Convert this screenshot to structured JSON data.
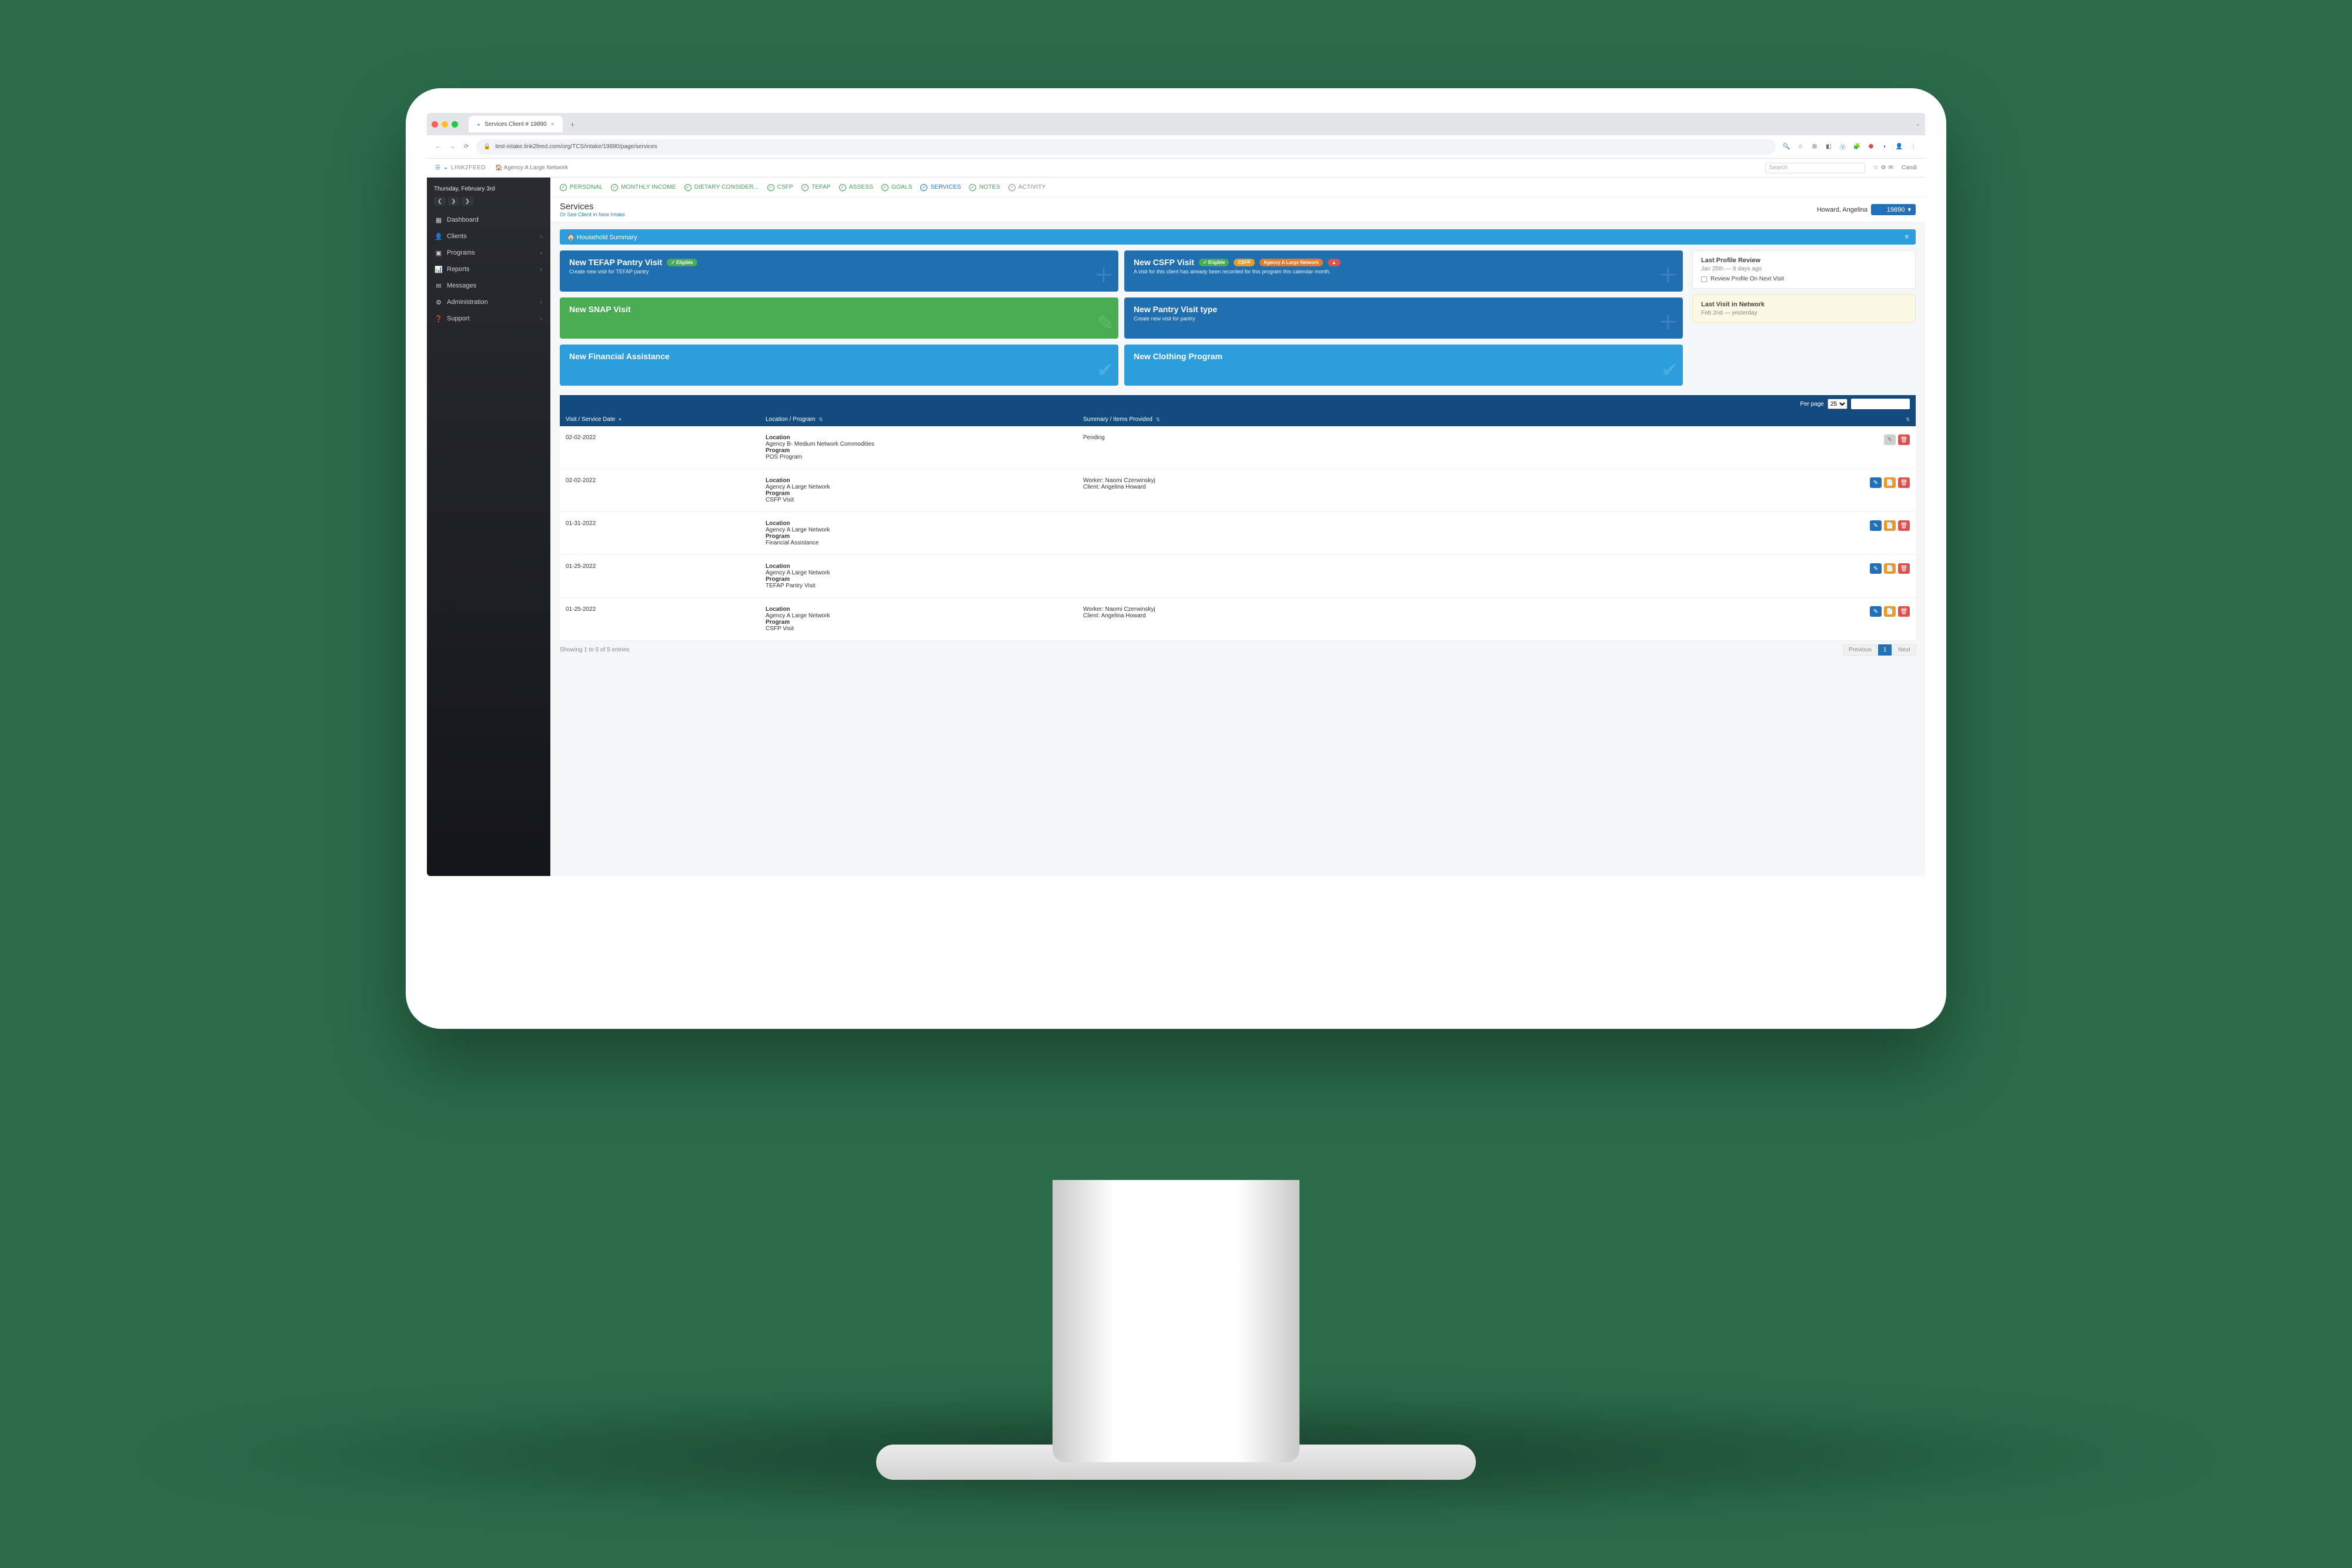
{
  "browser": {
    "tab_title": "Services Client # 19890",
    "url": "test-intake.link2feed.com/org/TCS/intake/19890/page/services"
  },
  "app_bar": {
    "brand": "LINK2FEED",
    "agency": "Agency A Large Network",
    "search_placeholder": "Search",
    "right_icons": [
      "☆",
      "⚙",
      "✉"
    ],
    "user_abbrev": "Candi"
  },
  "sidebar": {
    "date": "Thursday, February 3rd",
    "items": [
      {
        "icon": "▦",
        "label": "Dashboard",
        "expandable": false
      },
      {
        "icon": "👤",
        "label": "Clients",
        "expandable": true
      },
      {
        "icon": "▣",
        "label": "Programs",
        "expandable": true
      },
      {
        "icon": "📊",
        "label": "Reports",
        "expandable": true
      },
      {
        "icon": "✉",
        "label": "Messages",
        "expandable": false
      },
      {
        "icon": "⚙",
        "label": "Administration",
        "expandable": true
      },
      {
        "icon": "❓",
        "label": "Support",
        "expandable": true
      }
    ]
  },
  "profile_tabs": [
    {
      "label": "PERSONAL"
    },
    {
      "label": "MONTHLY INCOME"
    },
    {
      "label": "DIETARY CONSIDER..."
    },
    {
      "label": "CSFP"
    },
    {
      "label": "TEFAP"
    },
    {
      "label": "ASSESS"
    },
    {
      "label": "GOALS"
    },
    {
      "label": "SERVICES",
      "selected": true
    },
    {
      "label": "NOTES"
    },
    {
      "label": "ACTIVITY",
      "plain": true
    }
  ],
  "header": {
    "title": "Services",
    "sublink": "Or See Client in New Intake",
    "client_name": "Howard, Angelina",
    "client_id": "19890"
  },
  "household_bar": "Household Summary",
  "action_cards": {
    "tefap": {
      "title": "New TEFAP Pantry Visit",
      "badge": "✓ Eligible",
      "sub": "Create new visit for TEFAP pantry"
    },
    "csfp": {
      "title": "New CSFP Visit",
      "badges": [
        "✓ Eligible",
        "CSFP",
        "Agency A Large Network",
        "▲"
      ],
      "sub": "A visit for this client has already been recorded for this program this calendar month."
    },
    "snap": {
      "title": "New SNAP Visit"
    },
    "pantry": {
      "title": "New Pantry Visit type",
      "sub": "Create new visit for pantry"
    },
    "fin": {
      "title": "New Financial Assistance"
    },
    "cloth": {
      "title": "New Clothing Program"
    }
  },
  "review_box": {
    "title": "Last Profile Review",
    "date": "Jan 25th — 8 days ago",
    "check": "Review Profile On Next Visit"
  },
  "lastvisit_box": {
    "title": "Last Visit in Network",
    "date": "Feb 2nd — yesterday"
  },
  "table": {
    "perpage_label": "Per page",
    "perpage_value": "25",
    "columns": [
      "Visit / Service Date",
      "Location / Program",
      "Summary / Items Provided",
      ""
    ],
    "rows": [
      {
        "date": "02-02-2022",
        "loc_lines": [
          "Location",
          "Agency B- Medium Network Commodities",
          "Program",
          "POS Program"
        ],
        "summary_lines": [
          "Pending"
        ],
        "actions": [
          "grey",
          "red"
        ]
      },
      {
        "date": "02-02-2022",
        "loc_lines": [
          "Location",
          "Agency A Large Network",
          "Program",
          "CSFP Visit"
        ],
        "summary_lines": [
          "Worker: Naomi Czerwinskyj",
          "Client: Angelina Howard"
        ],
        "actions": [
          "blue",
          "orange",
          "red"
        ]
      },
      {
        "date": "01-31-2022",
        "loc_lines": [
          "Location",
          "Agency A Large Network",
          "Program",
          "Financial Assistance"
        ],
        "summary_lines": [],
        "actions": [
          "blue",
          "orange",
          "red"
        ]
      },
      {
        "date": "01-25-2022",
        "loc_lines": [
          "Location",
          "Agency A Large Network",
          "Program",
          "TEFAP Pantry Visit"
        ],
        "summary_lines": [],
        "actions": [
          "blue",
          "orange",
          "red"
        ]
      },
      {
        "date": "01-25-2022",
        "loc_lines": [
          "Location",
          "Agency A Large Network",
          "Program",
          "CSFP Visit"
        ],
        "summary_lines": [
          "Worker: Naomi Czerwinskyj",
          "Client: Angelina Howard"
        ],
        "actions": [
          "blue",
          "orange",
          "red"
        ]
      }
    ],
    "footer_text": "Showing 1 to 5 of 5 entries",
    "pager": [
      "Previous",
      "1",
      "Next"
    ]
  }
}
